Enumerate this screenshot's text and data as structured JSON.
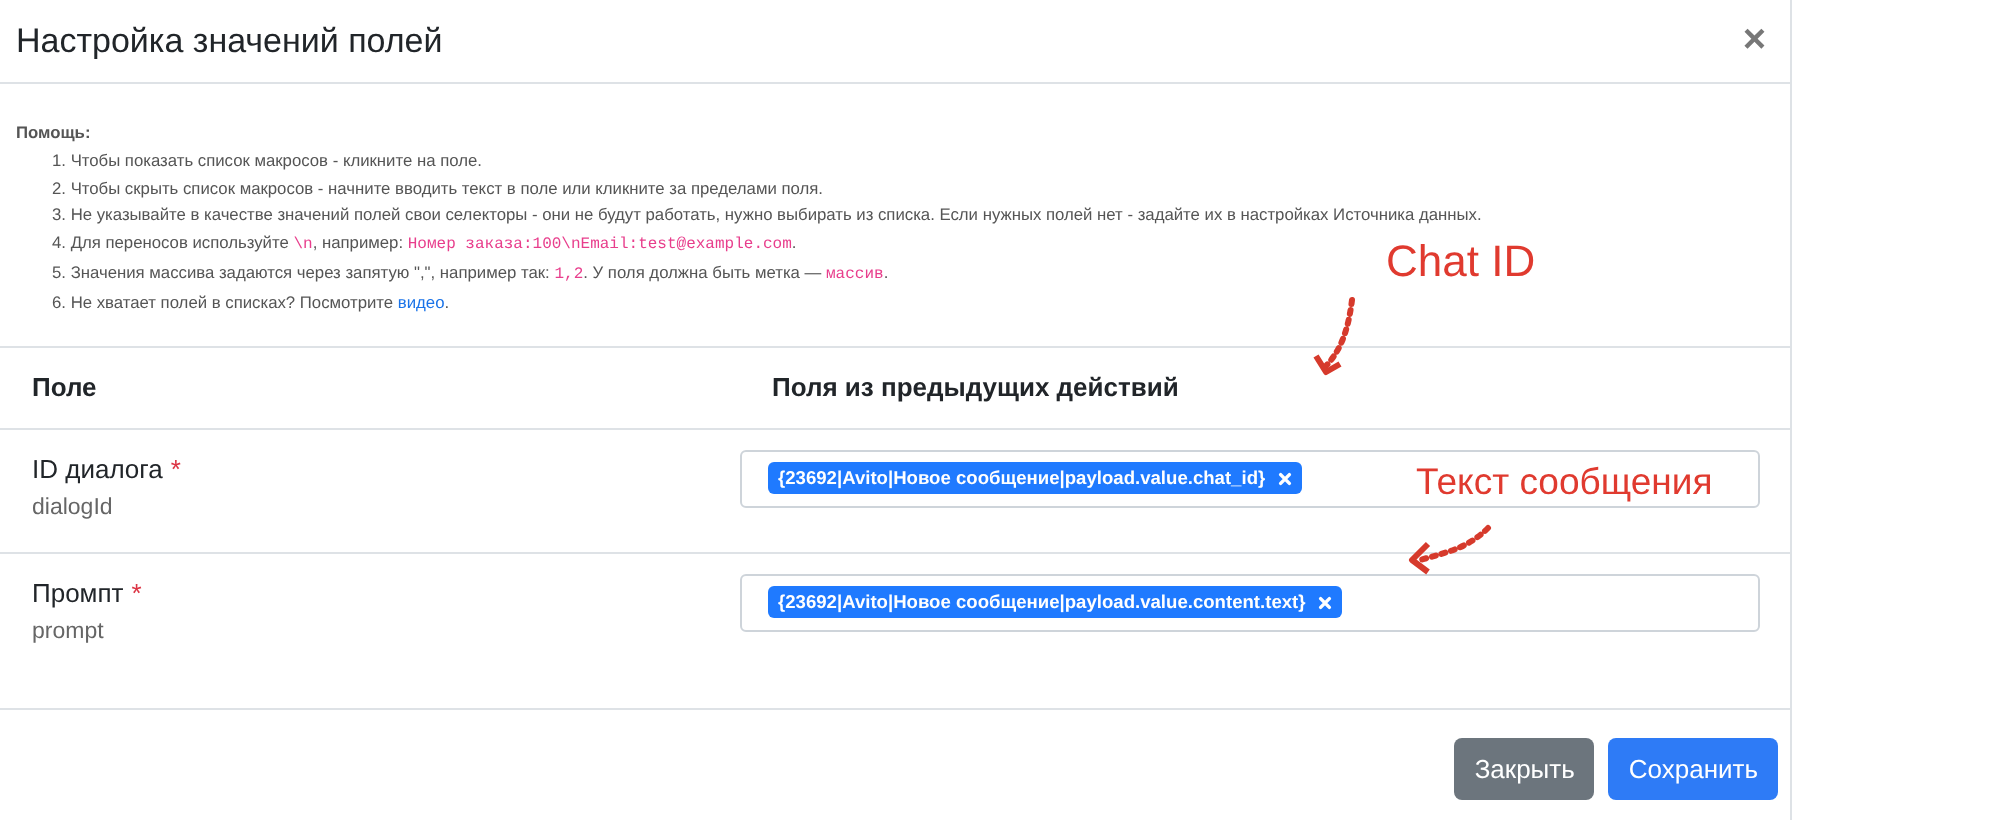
{
  "dialog": {
    "title": "Настройка значений полей",
    "close": "×"
  },
  "help": {
    "title": "Помощь:",
    "items": [
      {
        "number": "1.",
        "parts": [
          {
            "kind": "text",
            "text": "Чтобы показать список макросов - кликните на поле."
          }
        ]
      },
      {
        "number": "2.",
        "parts": [
          {
            "kind": "text",
            "text": "Чтобы скрыть список макросов - начните вводить текст в поле или кликните за пределами поля."
          }
        ]
      },
      {
        "number": "3.",
        "parts": [
          {
            "kind": "text",
            "text": "Не указывайте в качестве значений полей свои селекторы - они не будут работать, нужно выбирать из списка. Если нужных полей нет - задайте их в настройках Источника данных."
          }
        ]
      },
      {
        "number": "4.",
        "parts": [
          {
            "kind": "text",
            "text": "Для переносов используйте "
          },
          {
            "kind": "code",
            "text": "\\n"
          },
          {
            "kind": "text",
            "text": ", например: "
          },
          {
            "kind": "code",
            "text": "Номер заказа:100\\nEmail:test@example.com"
          },
          {
            "kind": "text",
            "text": "."
          }
        ]
      },
      {
        "number": "5.",
        "parts": [
          {
            "kind": "text",
            "text": "Значения массива задаются через запятую \",\", например так: "
          },
          {
            "kind": "code",
            "text": "1,2"
          },
          {
            "kind": "text",
            "text": ". У поля должна быть метка — "
          },
          {
            "kind": "code",
            "text": "массив"
          },
          {
            "kind": "text",
            "text": "."
          }
        ]
      },
      {
        "number": "6.",
        "parts": [
          {
            "kind": "text",
            "text": "Не хватает полей в списках? Посмотрите "
          },
          {
            "kind": "link",
            "text": "видео"
          },
          {
            "kind": "text",
            "text": "."
          }
        ]
      }
    ]
  },
  "table": {
    "columns": [
      "Поле",
      "Поля из предыдущих действий"
    ],
    "rows": [
      {
        "label": "ID диалога",
        "required": true,
        "required_mark": "*",
        "key": "dialogId",
        "tags": [
          "{23692|Avito|Новое сообщение|payload.value.chat_id}"
        ]
      },
      {
        "label": "Промпт",
        "required": true,
        "required_mark": "*",
        "key": "prompt",
        "tags": [
          "{23692|Avito|Новое сообщение|payload.value.content.text}"
        ]
      }
    ]
  },
  "annotations": [
    {
      "text": "Chat ID"
    },
    {
      "text": "Текст сообщения"
    }
  ],
  "buttons": [
    {
      "label": "Закрыть",
      "kind": "secondary"
    },
    {
      "label": "Сохранить",
      "kind": "primary"
    }
  ]
}
